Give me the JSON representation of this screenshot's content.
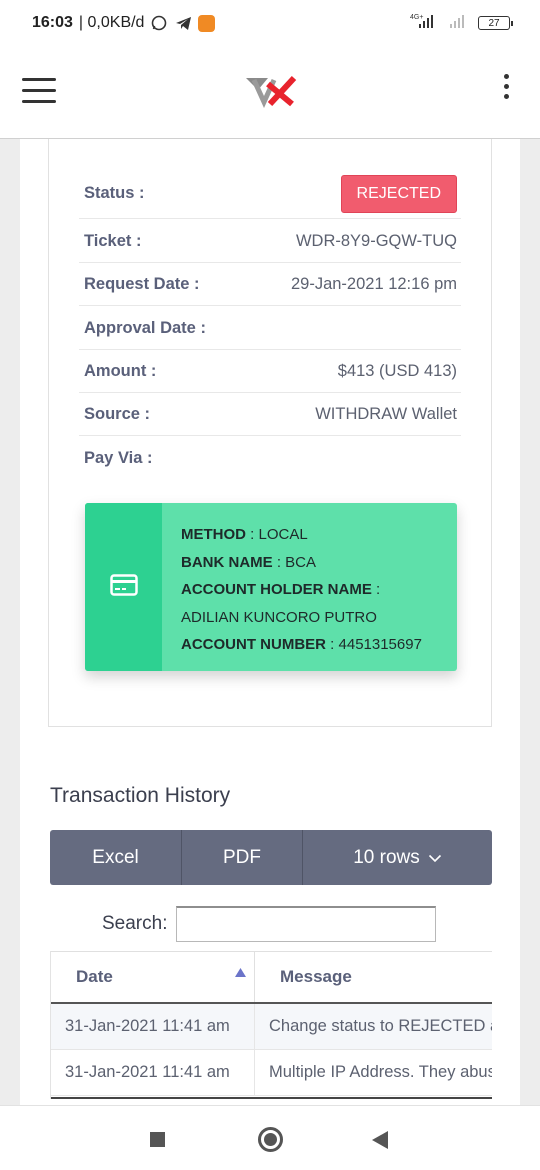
{
  "statusbar": {
    "time": "16:03",
    "network": "| 0,0KB/d",
    "signal": "4G+",
    "battery": "27"
  },
  "icons": {
    "menu": "hamburger-menu-icon",
    "logo": "app-logo",
    "more": "vertical-dots-icon",
    "card": "credit-card-icon",
    "sort": "sort-ascending-icon",
    "chevron": "chevron-down-icon"
  },
  "colors": {
    "rejected": "#f15c6e",
    "pay_box": "#5ee0aa",
    "pay_box_icon": "#2dd191",
    "button_group": "#656b80",
    "logo_red": "#e8232d"
  },
  "detail": {
    "status_label": "Status :",
    "status_value": "REJECTED",
    "ticket_label": "Ticket :",
    "ticket_value": "WDR-8Y9-GQW-TUQ",
    "request_date_label": "Request Date :",
    "request_date_value": "29-Jan-2021 12:16 pm",
    "approval_date_label": "Approval Date :",
    "approval_date_value": "",
    "amount_label": "Amount :",
    "amount_value": "$413 (USD 413)",
    "source_label": "Source :",
    "source_value": "WITHDRAW Wallet",
    "payvia_label": "Pay Via :"
  },
  "payment": {
    "method_label": "METHOD",
    "method_value": ": LOCAL",
    "bank_label": "BANK NAME",
    "bank_value": ": BCA",
    "holder_label": "ACCOUNT HOLDER NAME",
    "holder_sep": ":",
    "holder_value": "ADILIAN KUNCORO PUTRO",
    "number_label": "ACCOUNT NUMBER",
    "number_value": ": 4451315697"
  },
  "history": {
    "title": "Transaction History",
    "excel_label": "Excel",
    "pdf_label": "PDF",
    "rows_label": "10 rows",
    "search_label": "Search:",
    "search_value": "",
    "columns": [
      "Date",
      "Message"
    ],
    "rows": [
      {
        "date": "31-Jan-2021 11:41 am",
        "message": "Change status to REJECTED and"
      },
      {
        "date": "31-Jan-2021 11:41 am",
        "message": "Multiple IP Address. They abuse"
      }
    ]
  }
}
